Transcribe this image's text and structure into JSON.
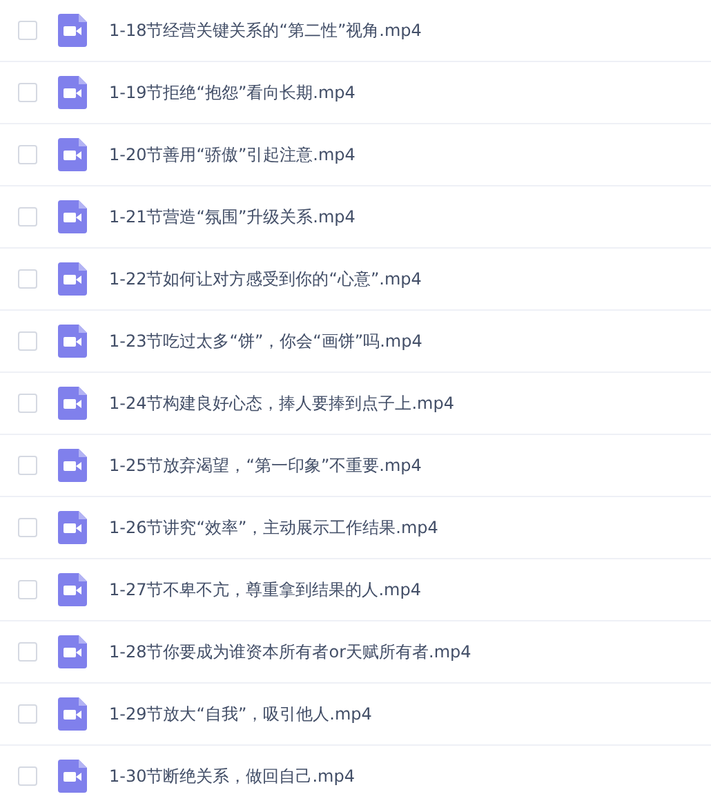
{
  "files": [
    {
      "name": "1-18节经营关键关系的“第二性”视角.mp4",
      "checked": false
    },
    {
      "name": "1-19节拒绝“抱怨”看向长期.mp4",
      "checked": false
    },
    {
      "name": "1-20节善用“骄傲”引起注意.mp4",
      "checked": false
    },
    {
      "name": "1-21节营造“氛围”升级关系.mp4",
      "checked": false
    },
    {
      "name": "1-22节如何让对方感受到你的“心意”.mp4",
      "checked": false
    },
    {
      "name": "1-23节吃过太多“饼”，你会“画饼”吗.mp4",
      "checked": false
    },
    {
      "name": "1-24节构建良好心态，捧人要捧到点子上.mp4",
      "checked": false
    },
    {
      "name": "1-25节放弃渴望，“第一印象”不重要.mp4",
      "checked": false
    },
    {
      "name": "1-26节讲究“效率”，主动展示工作结果.mp4",
      "checked": false
    },
    {
      "name": "1-27节不卑不亢，尊重拿到结果的人.mp4",
      "checked": false
    },
    {
      "name": "1-28节你要成为谁资本所有者or天赋所有者.mp4",
      "checked": false
    },
    {
      "name": "1-29节放大“自我”，吸引他人.mp4",
      "checked": false
    },
    {
      "name": "1-30节断绝关系，做回自己.mp4",
      "checked": false
    }
  ]
}
